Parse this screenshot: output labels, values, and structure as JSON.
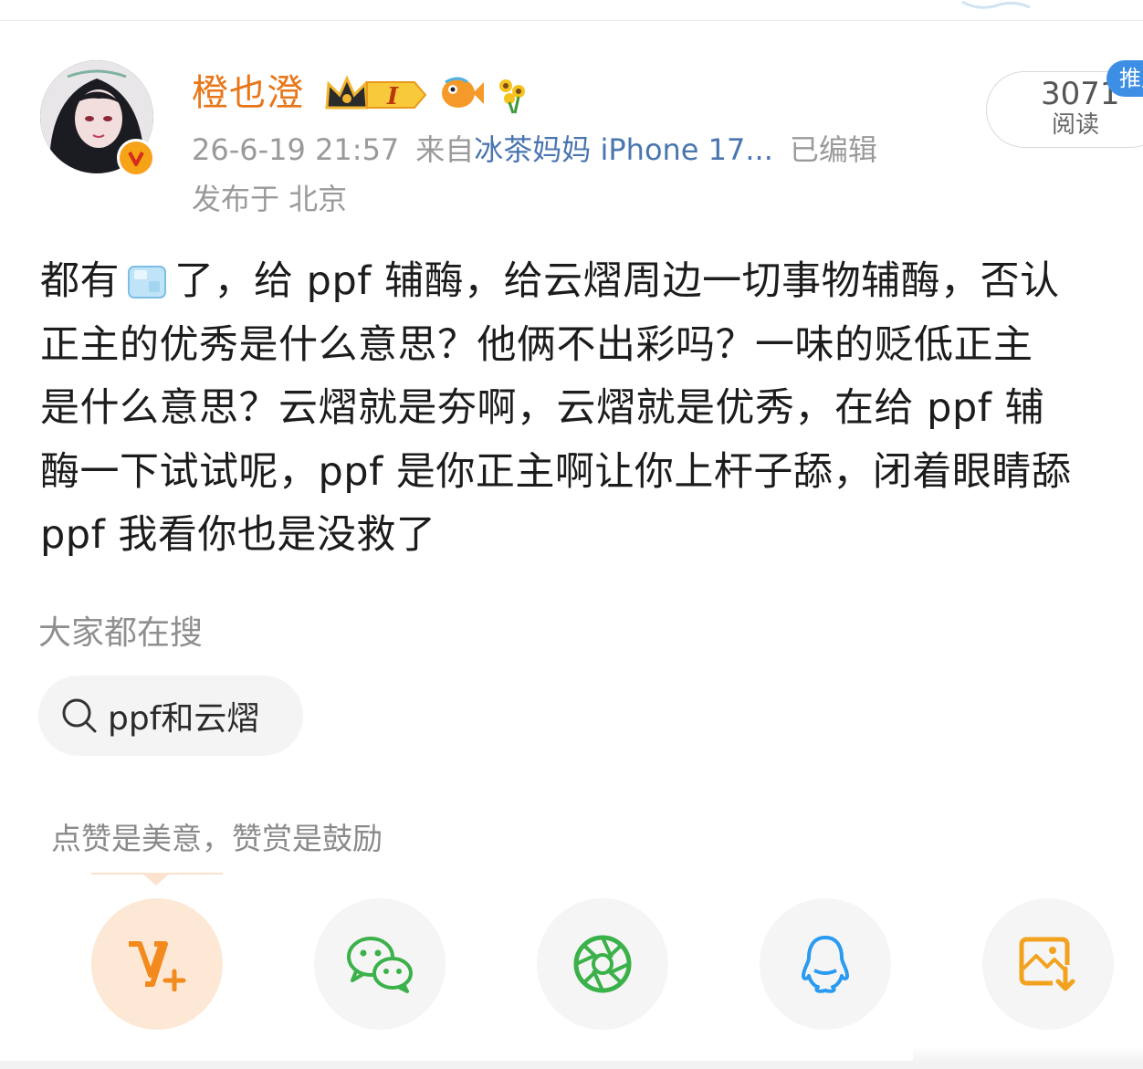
{
  "header": {
    "username": "橙也澄",
    "timestamp": "26-6-19 21:57",
    "source_prefix": "来自",
    "device": "冰茶妈妈 iPhone 17...",
    "edited": "已编辑",
    "location": "发布于 北京",
    "level_badge": "I",
    "avatar_badge": "V"
  },
  "stats": {
    "read_count": "3071",
    "read_label": "阅读",
    "promo_label": "推广"
  },
  "post": {
    "lines": [
      {
        "before": "都有",
        "after": "了，给 ppf 辅酶，给云熠周边一切事物辅酶，否认"
      },
      {
        "text": "正主的优秀是什么意思？他俩不出彩吗？一味的贬低正主"
      },
      {
        "text": "是什么意思？云熠就是夯啊，云熠就是优秀，在给 ppf 辅"
      },
      {
        "text": "酶一下试试呢，ppf 是你正主啊让你上杆子舔，闭着眼睛舔"
      },
      {
        "text": "ppf 我看你也是没救了"
      }
    ]
  },
  "search": {
    "heading": "大家都在搜",
    "chip": "ppf和云熠"
  },
  "reward": {
    "tip": "点赞是美意，赞赏是鼓励"
  },
  "share": {
    "items": [
      {
        "icon": "weibo-reward-icon",
        "color": "#f28a1e"
      },
      {
        "icon": "wechat-icon",
        "color": "#3bb14a"
      },
      {
        "icon": "moments-icon",
        "color": "#3bb14a"
      },
      {
        "icon": "qq-icon",
        "color": "#2a9bf0"
      },
      {
        "icon": "save-image-icon",
        "color": "#f2a21e"
      }
    ]
  },
  "colors": {
    "username": "#e8771a",
    "device": "#4a76b0",
    "meta": "#9a9a9a",
    "promo": "#3d8fe6"
  }
}
